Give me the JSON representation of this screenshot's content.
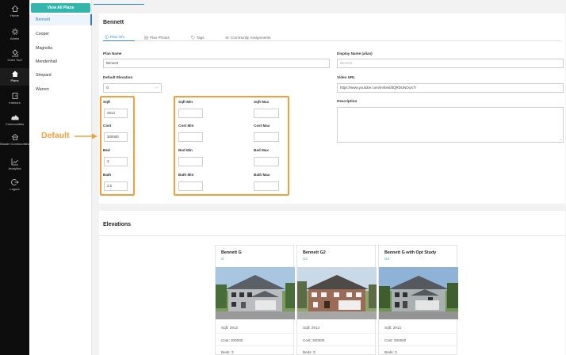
{
  "nav": {
    "items": [
      {
        "label": "Home",
        "icon": "home-icon"
      },
      {
        "label": "Admin",
        "icon": "gear-icon"
      },
      {
        "label": "Color Tool",
        "icon": "paint-bucket-icon"
      },
      {
        "label": "Plans",
        "icon": "house-icon",
        "active": true
      },
      {
        "label": "Interiors",
        "icon": "door-icon"
      },
      {
        "label": "Communities",
        "icon": "neighborhood-icon"
      },
      {
        "label": "Master Communities",
        "icon": "master-community-icon"
      },
      {
        "label": "Analytics",
        "icon": "chart-icon"
      },
      {
        "label": "Logout",
        "icon": "logout-icon"
      }
    ]
  },
  "plans": {
    "view_all_label": "View All Plans",
    "items": [
      "Bennett",
      "Cooper",
      "Magnolia",
      "Mendenhall",
      "Shepard",
      "Warren"
    ]
  },
  "plan": {
    "title": "Bennett",
    "tabs": [
      {
        "label": "Plan Info",
        "icon": "info-icon",
        "active": true
      },
      {
        "label": "Plan Photos",
        "icon": "camera-icon"
      },
      {
        "label": "Tags",
        "icon": "tag-icon"
      },
      {
        "label": "Community Assignments",
        "icon": "list-icon"
      }
    ],
    "fields": {
      "plan_name": {
        "label": "Plan Name",
        "value": "Bennett"
      },
      "display_name": {
        "label": "Display Name (alias)",
        "placeholder": "Bennett"
      },
      "default_elevation": {
        "label": "Default Elevation",
        "value": "G"
      },
      "video_url": {
        "label": "Video URL",
        "value": "https://www.youtube.com/embed/dQRDUNOuX7I"
      },
      "description": {
        "label": "Description",
        "value": ""
      },
      "sqft": {
        "label": "Sqft",
        "value": "2913"
      },
      "cost": {
        "label": "Cost",
        "value": "300000"
      },
      "bed": {
        "label": "Bed",
        "value": "3"
      },
      "bath": {
        "label": "Bath",
        "value": "2.5"
      },
      "sqft_min": {
        "label": "Sqft Min",
        "value": ""
      },
      "sqft_max": {
        "label": "Sqft Max",
        "value": ""
      },
      "cost_min": {
        "label": "Cost Min",
        "value": ""
      },
      "cost_max": {
        "label": "Cost Max",
        "value": ""
      },
      "bed_min": {
        "label": "Bed Min",
        "value": ""
      },
      "bed_max": {
        "label": "Bed Max",
        "value": ""
      },
      "bath_min": {
        "label": "Bath Min",
        "value": ""
      },
      "bath_max": {
        "label": "Bath Max",
        "value": ""
      }
    }
  },
  "annotation": {
    "label": "Default",
    "color": "#f0a040"
  },
  "elevations": {
    "title": "Elevations",
    "cards": [
      {
        "name": "Bennett G",
        "code": "G",
        "sqft": "Sqft: 2913",
        "cost": "Cost: 300000",
        "beds": "Beds: 3",
        "house_color": "#b9bcc0"
      },
      {
        "name": "Bennett G2",
        "code": "G2",
        "sqft": "Sqft: 2913",
        "cost": "Cost: 300000",
        "beds": "Beds: 3",
        "house_color": "#9a6b57"
      },
      {
        "name": "Bennett G with Opt Study",
        "code": "GS",
        "sqft": "Sqft: 2913",
        "cost": "Cost: 300000",
        "beds": "Beds: 3",
        "house_color": "#a9b0b2"
      }
    ]
  },
  "colors": {
    "accent": "#34b6ad",
    "link": "#3a8bd6",
    "highlight": "#f0a040"
  }
}
